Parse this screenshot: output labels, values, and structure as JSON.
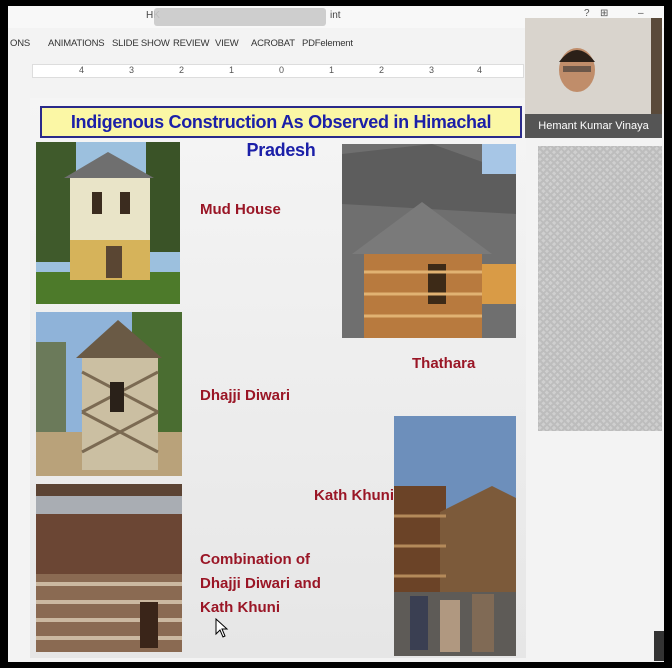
{
  "window": {
    "title_left": "HK",
    "title_right": "int",
    "controls": [
      "?",
      "⊞",
      "–",
      "□"
    ]
  },
  "ribbon": {
    "tabs": [
      "ONS",
      "ANIMATIONS",
      "SLIDE SHOW",
      "REVIEW",
      "VIEW",
      "ACROBAT",
      "PDFelement"
    ]
  },
  "ruler": {
    "ticks": [
      "4",
      "3",
      "2",
      "1",
      "0",
      "1",
      "2",
      "3",
      "4"
    ]
  },
  "slide": {
    "title": "Indigenous Construction As Observed in Himachal Pradesh",
    "labels": {
      "mud_house": "Mud House",
      "dhajji": "Dhajji Diwari",
      "thathara": "Thathara",
      "kath_khuni": "Kath Khuni",
      "combo_1": "Combination of",
      "combo_2": "Dhajji Diwari and",
      "combo_3": "Kath Khuni"
    }
  },
  "participant": {
    "name": "Hemant Kumar Vinaya"
  },
  "colors": {
    "title_text": "#1b1fa8",
    "title_bg": "#fbf7a5",
    "label_text": "#9a1626"
  }
}
